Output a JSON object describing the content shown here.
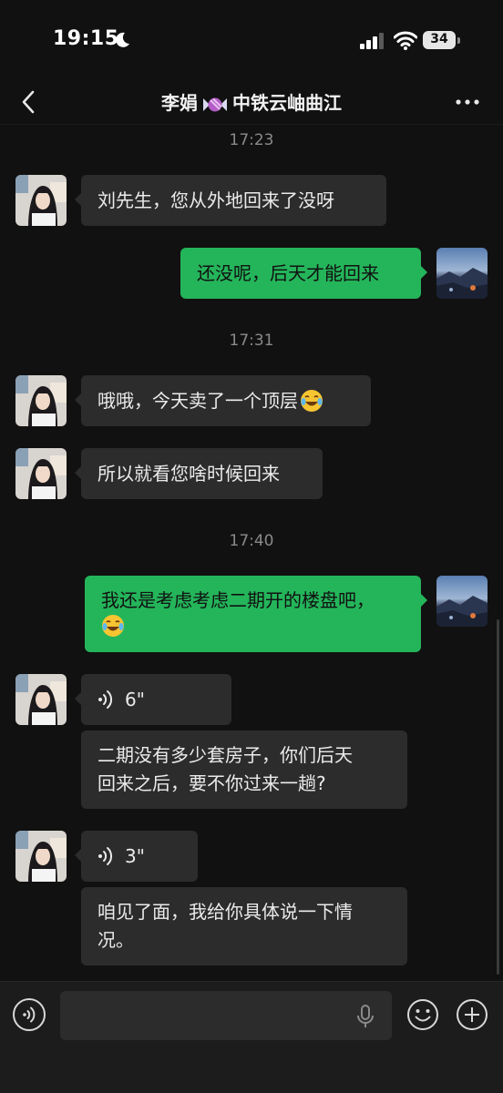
{
  "status_bar": {
    "time": "19:15",
    "battery": "34"
  },
  "nav": {
    "contact_name": "李娟",
    "contact_suffix": "中铁云岫曲江"
  },
  "messages": {
    "t1": "17:23",
    "m1": "刘先生，您从外地回来了没呀",
    "m2": "还没呢，后天才能回来",
    "t2": "17:31",
    "m3": "哦哦，今天卖了一个顶层",
    "m4": "所以就看您啥时候回来",
    "t3": "17:40",
    "m5_line1": "我还是考虑考虑二期开的楼盘吧，",
    "v1": "6\"",
    "m6_line1": "二期没有多少套房子，你们后天",
    "m6_line2": "回来之后，要不你过来一趟?",
    "v2": "3\"",
    "m7_line1": "咱见了面，我给你具体说一下情",
    "m7_line2": "况。"
  },
  "colors": {
    "background": "#111111",
    "incoming_bubble": "#2c2c2c",
    "outgoing_bubble": "#24b55a"
  },
  "icons": [
    "back-icon",
    "candy-icon",
    "more-icon",
    "voice-wave-icon",
    "cry-laugh-emoji",
    "mic-icon",
    "emoji-icon",
    "plus-icon"
  ]
}
